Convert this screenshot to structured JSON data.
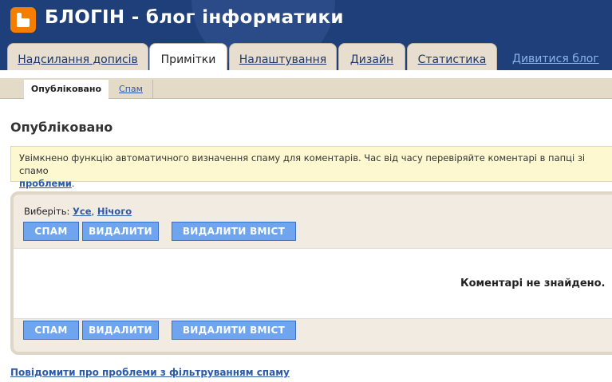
{
  "header": {
    "title": "БЛОГІН - блог інформатики",
    "logo_icon": "blogger-logo-icon"
  },
  "tabs": [
    {
      "label": "Надсилання дописів"
    },
    {
      "label": "Примітки"
    },
    {
      "label": "Налаштування"
    },
    {
      "label": "Дизайн"
    },
    {
      "label": "Статистика"
    }
  ],
  "view_blog": "Дивитися блог",
  "subtabs": {
    "published": "Опубліковано",
    "spam": "Спам"
  },
  "page_title": "Опубліковано",
  "notice": {
    "text": "Увімкнено функцію автоматичного визначення спаму для коментарів. Час від часу перевіряйте коментарі в папці зі спамо",
    "link": "проблеми",
    "tail": "."
  },
  "select": {
    "label": "Виберіть: ",
    "all": "Усе",
    "sep": ", ",
    "none": "Нічого"
  },
  "buttons": {
    "spam": "СПАМ",
    "delete": "ВИДАЛИТИ",
    "delete_content": "ВИДАЛИТИ ВМІСТ"
  },
  "empty_message": "Коментарі не знайдено.",
  "footer_link": "Повідомити про проблеми з фільтруванням спаму",
  "colors": {
    "header_bg": "#1e3f7a",
    "tab_bg": "#e7decf",
    "button_bg": "#6ea5ee",
    "notice_bg": "#fdf8d0",
    "link": "#2c5aa7"
  }
}
